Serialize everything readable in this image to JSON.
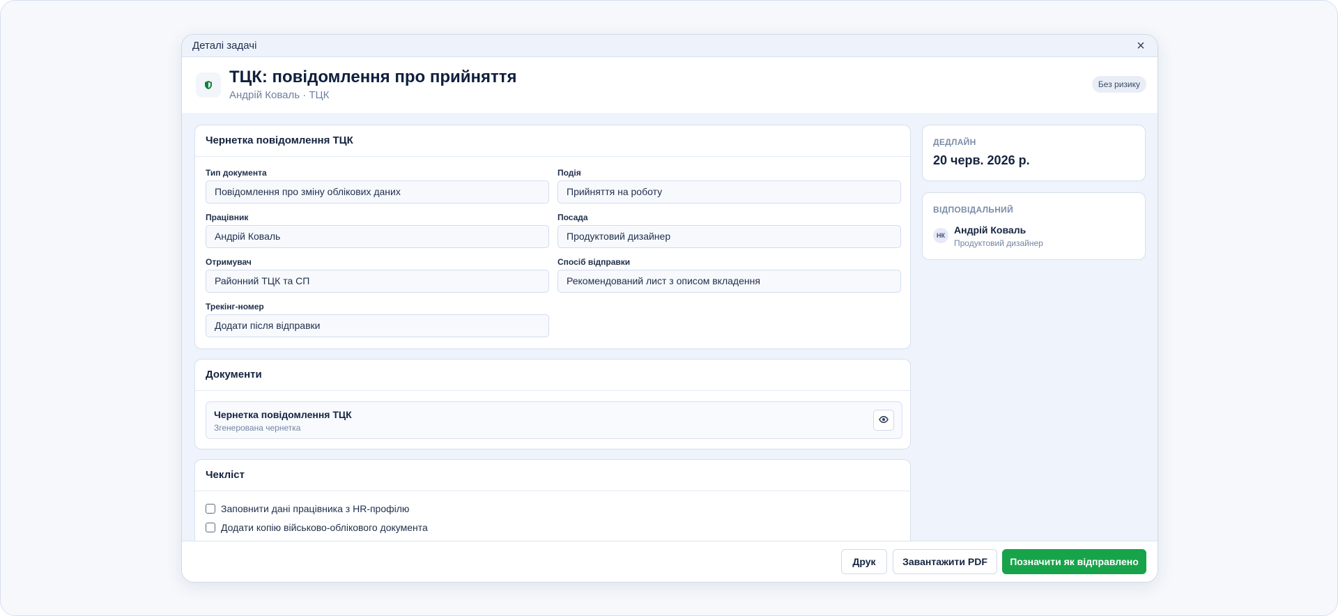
{
  "modal": {
    "window_title": "Деталі задачі",
    "title": "ТЦК: повідомлення про прийняття",
    "subtitle": "Андрій Коваль · ТЦК",
    "risk_badge": "Без ризику",
    "close_icon": "close-icon",
    "header_icon": "shield-icon",
    "accent_color": "#17a34a"
  },
  "draft": {
    "heading": "Чернетка повідомлення ТЦК",
    "fields": {
      "doc_type": {
        "label": "Тип документа",
        "value": "Повідомлення про зміну облікових даних"
      },
      "event": {
        "label": "Подія",
        "value": "Прийняття на роботу"
      },
      "employee": {
        "label": "Працівник",
        "value": "Андрій Коваль"
      },
      "position": {
        "label": "Посада",
        "value": "Продуктовий дизайнер"
      },
      "recipient": {
        "label": "Отримувач",
        "value": "Районний ТЦК та СП"
      },
      "delivery": {
        "label": "Спосіб відправки",
        "value": "Рекомендований лист з описом вкладення"
      },
      "tracking": {
        "label": "Трекінг-номер",
        "placeholder": "Додати після відправки"
      }
    }
  },
  "documents": {
    "heading": "Документи",
    "items": [
      {
        "title": "Чернетка повідомлення ТЦК",
        "subtitle": "Згенерована чернетка",
        "action_icon": "eye-icon"
      }
    ]
  },
  "checklist": {
    "heading": "Чекліст",
    "items": [
      {
        "label": "Заповнити дані працівника з HR-профілю",
        "checked": false
      },
      {
        "label": "Додати копію військово-облікового документа",
        "checked": false
      }
    ]
  },
  "sidebar": {
    "deadline": {
      "label": "ДЕДЛАЙН",
      "value": "20 черв. 2026 р."
    },
    "responsible": {
      "label": "ВІДПОВІДАЛЬНИЙ",
      "initials": "НК",
      "name": "Андрій Коваль",
      "role": "Продуктовий дизайнер"
    }
  },
  "footer": {
    "print_label": "Друк",
    "download_label": "Завантажити PDF",
    "mark_sent_label": "Позначити як відправлено"
  }
}
